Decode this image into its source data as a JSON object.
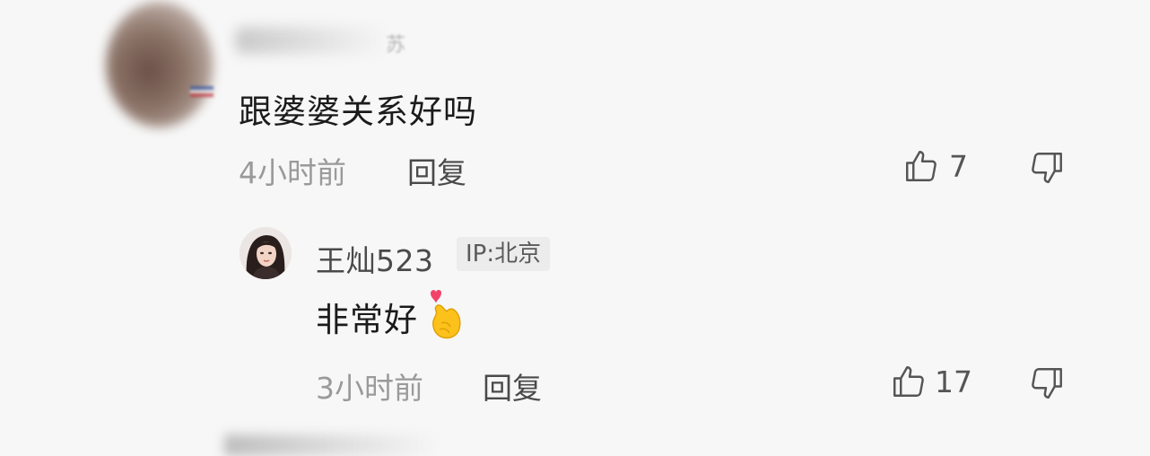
{
  "top_comment": {
    "text": "跟婆婆关系好吗",
    "time": "4小时前",
    "reply_label": "回复",
    "like_count": "7",
    "author_partial": "苏"
  },
  "reply_comment": {
    "author": "王灿523",
    "ip": "IP:北京",
    "text": "非常好",
    "emoji": "🫰",
    "time": "3小时前",
    "reply_label": "回复",
    "like_count": "17"
  },
  "icons": {
    "like": "thumbs-up-icon",
    "dislike": "thumbs-down-icon",
    "emoji": "finger-heart-emoji"
  }
}
